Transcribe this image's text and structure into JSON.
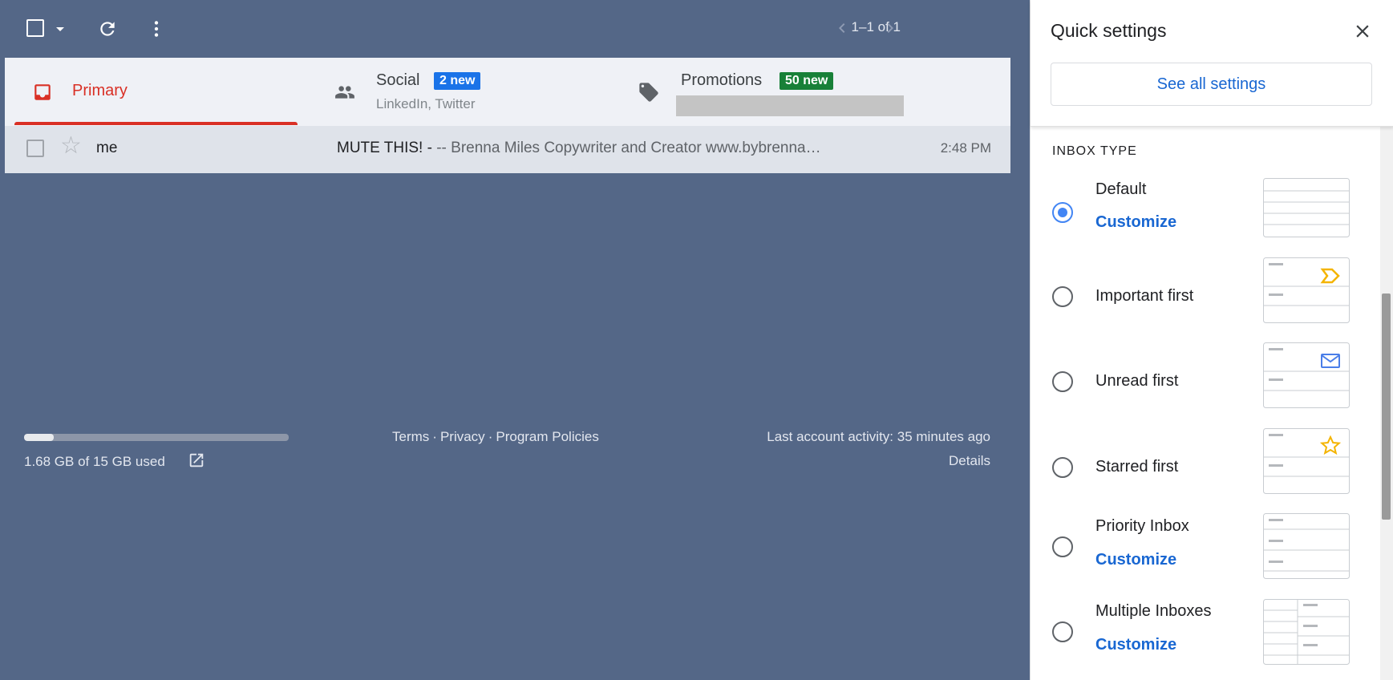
{
  "toolbar": {
    "pager": "1–1 of 1"
  },
  "tabs": [
    {
      "label": "Primary"
    },
    {
      "label": "Social",
      "badge": "2 new",
      "sub": "LinkedIn, Twitter"
    },
    {
      "label": "Promotions",
      "badge": "50 new"
    }
  ],
  "mail_rows": [
    {
      "sender": "me",
      "subject": "MUTE THIS! - ",
      "snippet": "-- Brenna Miles Copywriter and Creator www.bybrenna…",
      "time": "2:48 PM"
    }
  ],
  "footer": {
    "storage_text": "1.68 GB of 15 GB used",
    "storage_used_fraction": 0.112,
    "links": [
      "Terms",
      "Privacy",
      "Program Policies"
    ],
    "separator": "·",
    "activity": "Last account activity: 35 minutes ago",
    "details": "Details"
  },
  "quick_settings": {
    "title": "Quick settings",
    "see_all": "See all settings",
    "inbox_type_title": "INBOX TYPE",
    "options": [
      {
        "label": "Default",
        "link": "Customize",
        "selected": true
      },
      {
        "label": "Important first",
        "selected": false
      },
      {
        "label": "Unread first",
        "selected": false
      },
      {
        "label": "Starred first",
        "selected": false
      },
      {
        "label": "Priority Inbox",
        "link": "Customize",
        "selected": false
      },
      {
        "label": "Multiple Inboxes",
        "link": "Customize",
        "selected": false
      }
    ]
  },
  "colors": {
    "background": "#546787",
    "primary_red": "#d93025",
    "badge_blue": "#1a73e8",
    "badge_green": "#188038",
    "link_blue": "#1967d2",
    "radio_blue": "#4285f4",
    "important_yellow": "#f4b400"
  },
  "icons": {
    "select": "checkbox-icon",
    "refresh": "refresh-icon",
    "more": "more-vert-icon",
    "prev": "chevron-left-icon",
    "next": "chevron-right-icon",
    "primary": "inbox-icon",
    "social": "people-icon",
    "promotions": "tag-icon",
    "star": "star-icon",
    "external": "open-in-new-icon",
    "close": "close-icon"
  }
}
